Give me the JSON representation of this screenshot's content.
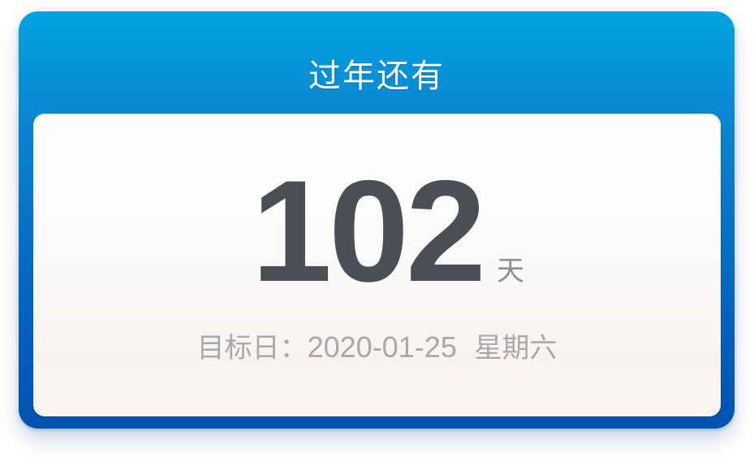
{
  "widget": {
    "title": "过年还有",
    "count": "102",
    "unit": "天",
    "target_label": "目标日：",
    "target_date": "2020-01-25",
    "target_weekday": "星期六"
  },
  "colors": {
    "header_blue_top": "#00a3e0",
    "header_blue_bottom": "#0052b0",
    "number_text": "#4a4f55",
    "secondary_text": "#a9a9a9"
  }
}
